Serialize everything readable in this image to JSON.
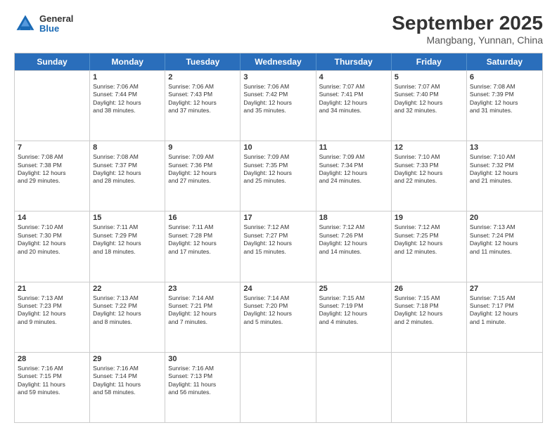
{
  "header": {
    "logo": {
      "line1": "General",
      "line2": "Blue"
    },
    "title": "September 2025",
    "subtitle": "Mangbang, Yunnan, China"
  },
  "weekdays": [
    "Sunday",
    "Monday",
    "Tuesday",
    "Wednesday",
    "Thursday",
    "Friday",
    "Saturday"
  ],
  "weeks": [
    [
      {
        "day": "",
        "info": ""
      },
      {
        "day": "1",
        "info": "Sunrise: 7:06 AM\nSunset: 7:44 PM\nDaylight: 12 hours\nand 38 minutes."
      },
      {
        "day": "2",
        "info": "Sunrise: 7:06 AM\nSunset: 7:43 PM\nDaylight: 12 hours\nand 37 minutes."
      },
      {
        "day": "3",
        "info": "Sunrise: 7:06 AM\nSunset: 7:42 PM\nDaylight: 12 hours\nand 35 minutes."
      },
      {
        "day": "4",
        "info": "Sunrise: 7:07 AM\nSunset: 7:41 PM\nDaylight: 12 hours\nand 34 minutes."
      },
      {
        "day": "5",
        "info": "Sunrise: 7:07 AM\nSunset: 7:40 PM\nDaylight: 12 hours\nand 32 minutes."
      },
      {
        "day": "6",
        "info": "Sunrise: 7:08 AM\nSunset: 7:39 PM\nDaylight: 12 hours\nand 31 minutes."
      }
    ],
    [
      {
        "day": "7",
        "info": "Sunrise: 7:08 AM\nSunset: 7:38 PM\nDaylight: 12 hours\nand 29 minutes."
      },
      {
        "day": "8",
        "info": "Sunrise: 7:08 AM\nSunset: 7:37 PM\nDaylight: 12 hours\nand 28 minutes."
      },
      {
        "day": "9",
        "info": "Sunrise: 7:09 AM\nSunset: 7:36 PM\nDaylight: 12 hours\nand 27 minutes."
      },
      {
        "day": "10",
        "info": "Sunrise: 7:09 AM\nSunset: 7:35 PM\nDaylight: 12 hours\nand 25 minutes."
      },
      {
        "day": "11",
        "info": "Sunrise: 7:09 AM\nSunset: 7:34 PM\nDaylight: 12 hours\nand 24 minutes."
      },
      {
        "day": "12",
        "info": "Sunrise: 7:10 AM\nSunset: 7:33 PM\nDaylight: 12 hours\nand 22 minutes."
      },
      {
        "day": "13",
        "info": "Sunrise: 7:10 AM\nSunset: 7:32 PM\nDaylight: 12 hours\nand 21 minutes."
      }
    ],
    [
      {
        "day": "14",
        "info": "Sunrise: 7:10 AM\nSunset: 7:30 PM\nDaylight: 12 hours\nand 20 minutes."
      },
      {
        "day": "15",
        "info": "Sunrise: 7:11 AM\nSunset: 7:29 PM\nDaylight: 12 hours\nand 18 minutes."
      },
      {
        "day": "16",
        "info": "Sunrise: 7:11 AM\nSunset: 7:28 PM\nDaylight: 12 hours\nand 17 minutes."
      },
      {
        "day": "17",
        "info": "Sunrise: 7:12 AM\nSunset: 7:27 PM\nDaylight: 12 hours\nand 15 minutes."
      },
      {
        "day": "18",
        "info": "Sunrise: 7:12 AM\nSunset: 7:26 PM\nDaylight: 12 hours\nand 14 minutes."
      },
      {
        "day": "19",
        "info": "Sunrise: 7:12 AM\nSunset: 7:25 PM\nDaylight: 12 hours\nand 12 minutes."
      },
      {
        "day": "20",
        "info": "Sunrise: 7:13 AM\nSunset: 7:24 PM\nDaylight: 12 hours\nand 11 minutes."
      }
    ],
    [
      {
        "day": "21",
        "info": "Sunrise: 7:13 AM\nSunset: 7:23 PM\nDaylight: 12 hours\nand 9 minutes."
      },
      {
        "day": "22",
        "info": "Sunrise: 7:13 AM\nSunset: 7:22 PM\nDaylight: 12 hours\nand 8 minutes."
      },
      {
        "day": "23",
        "info": "Sunrise: 7:14 AM\nSunset: 7:21 PM\nDaylight: 12 hours\nand 7 minutes."
      },
      {
        "day": "24",
        "info": "Sunrise: 7:14 AM\nSunset: 7:20 PM\nDaylight: 12 hours\nand 5 minutes."
      },
      {
        "day": "25",
        "info": "Sunrise: 7:15 AM\nSunset: 7:19 PM\nDaylight: 12 hours\nand 4 minutes."
      },
      {
        "day": "26",
        "info": "Sunrise: 7:15 AM\nSunset: 7:18 PM\nDaylight: 12 hours\nand 2 minutes."
      },
      {
        "day": "27",
        "info": "Sunrise: 7:15 AM\nSunset: 7:17 PM\nDaylight: 12 hours\nand 1 minute."
      }
    ],
    [
      {
        "day": "28",
        "info": "Sunrise: 7:16 AM\nSunset: 7:15 PM\nDaylight: 11 hours\nand 59 minutes."
      },
      {
        "day": "29",
        "info": "Sunrise: 7:16 AM\nSunset: 7:14 PM\nDaylight: 11 hours\nand 58 minutes."
      },
      {
        "day": "30",
        "info": "Sunrise: 7:16 AM\nSunset: 7:13 PM\nDaylight: 11 hours\nand 56 minutes."
      },
      {
        "day": "",
        "info": ""
      },
      {
        "day": "",
        "info": ""
      },
      {
        "day": "",
        "info": ""
      },
      {
        "day": "",
        "info": ""
      }
    ]
  ]
}
